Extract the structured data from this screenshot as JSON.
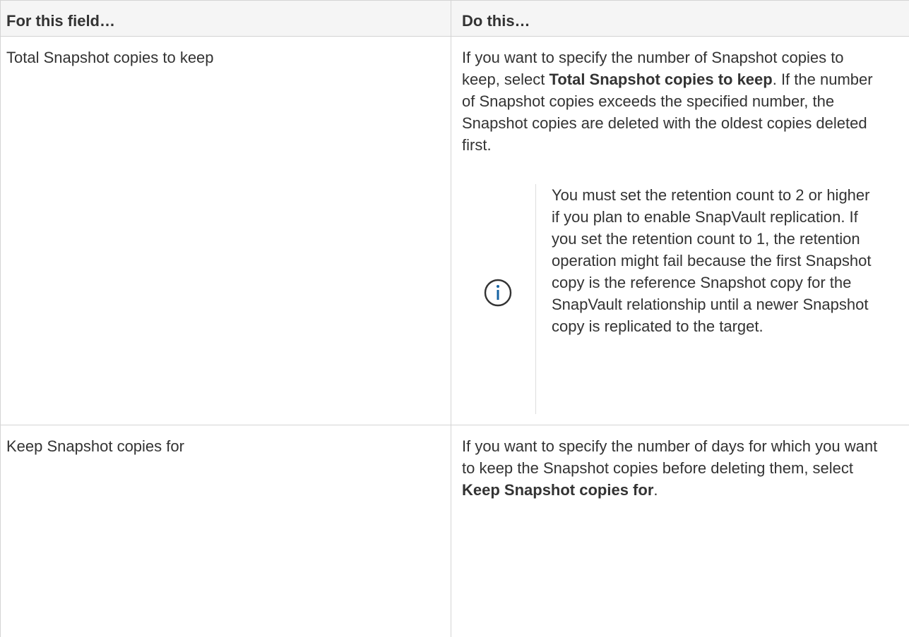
{
  "table": {
    "headers": [
      "For this field…",
      "Do this…"
    ],
    "rows": [
      {
        "field": "Total Snapshot copies to keep",
        "action_pre": "If you want to specify the number of Snapshot copies to keep, select ",
        "action_bold": "Total Snapshot copies to keep",
        "action_post": ". If the number of Snapshot copies exceeds the specified number, the Snapshot copies are deleted with the oldest copies deleted first.",
        "note": {
          "icon": "info-circle-icon",
          "text": "You must set the retention count to 2 or higher if you plan to enable SnapVault replication. If you set the retention count to 1, the retention operation might fail because the first Snapshot copy is the reference Snapshot copy for the SnapVault relationship until a newer Snapshot copy is replicated to the target."
        }
      },
      {
        "field": "Keep Snapshot copies for",
        "action_pre": "If you want to specify the number of days for which you want to keep the Snapshot copies before deleting them, select ",
        "action_bold": "Keep Snapshot copies for",
        "action_post": "."
      }
    ]
  },
  "colors": {
    "text": "#333333",
    "header_bg": "#f5f5f5",
    "border": "#d4d4d4",
    "icon": "#1563a3"
  }
}
